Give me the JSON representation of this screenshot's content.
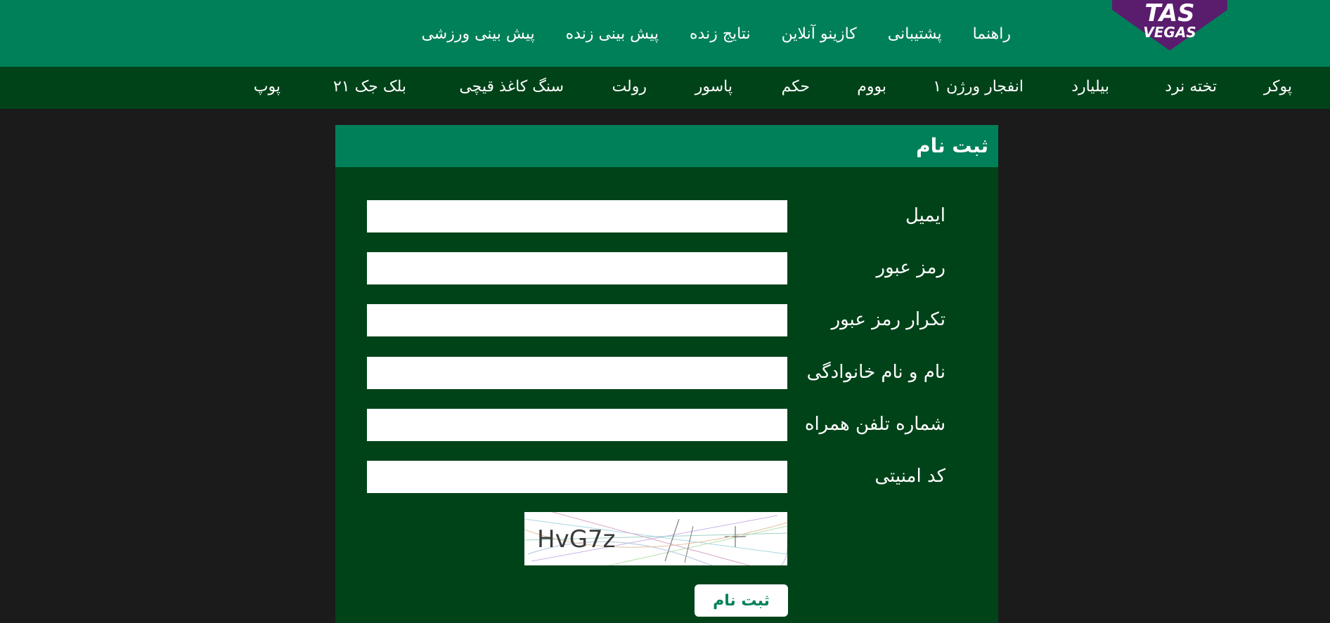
{
  "brand": {
    "logo_text_top": "TAS",
    "logo_text_bottom": "VEGAS",
    "logo_color": "#5a1d6e"
  },
  "top_nav": [
    {
      "label": "پیش بینی ورزشی"
    },
    {
      "label": "پیش بینی زنده"
    },
    {
      "label": "نتایج زنده"
    },
    {
      "label": "کازینو آنلاین"
    },
    {
      "label": "پشتیبانی"
    },
    {
      "label": "راهنما"
    }
  ],
  "games_nav": [
    {
      "label": "پوکر"
    },
    {
      "label": "تخته نرد"
    },
    {
      "label": "بیلیارد"
    },
    {
      "label": "انفجار ورژن ۱"
    },
    {
      "label": "بووم"
    },
    {
      "label": "حکم"
    },
    {
      "label": "پاسور"
    },
    {
      "label": "رولت"
    },
    {
      "label": "سنگ کاغذ قیچی"
    },
    {
      "label": "بلک جک ۲۱"
    },
    {
      "label": "پوپ"
    }
  ],
  "form": {
    "title": "ثبت نام",
    "fields": [
      {
        "label": "ایمیل",
        "value": ""
      },
      {
        "label": "رمز عبور",
        "value": ""
      },
      {
        "label": "تکرار رمز عبور",
        "value": ""
      },
      {
        "label": "نام و نام خانوادگی",
        "value": ""
      },
      {
        "label": "شماره تلفن همراه",
        "value": ""
      },
      {
        "label": "کد امنیتی",
        "value": ""
      }
    ],
    "captcha_text": "HvG7z",
    "submit_label": "ثبت نام"
  },
  "colors": {
    "primary_green": "#008059",
    "dark_green": "#004319",
    "background": "#1b1b1b"
  }
}
